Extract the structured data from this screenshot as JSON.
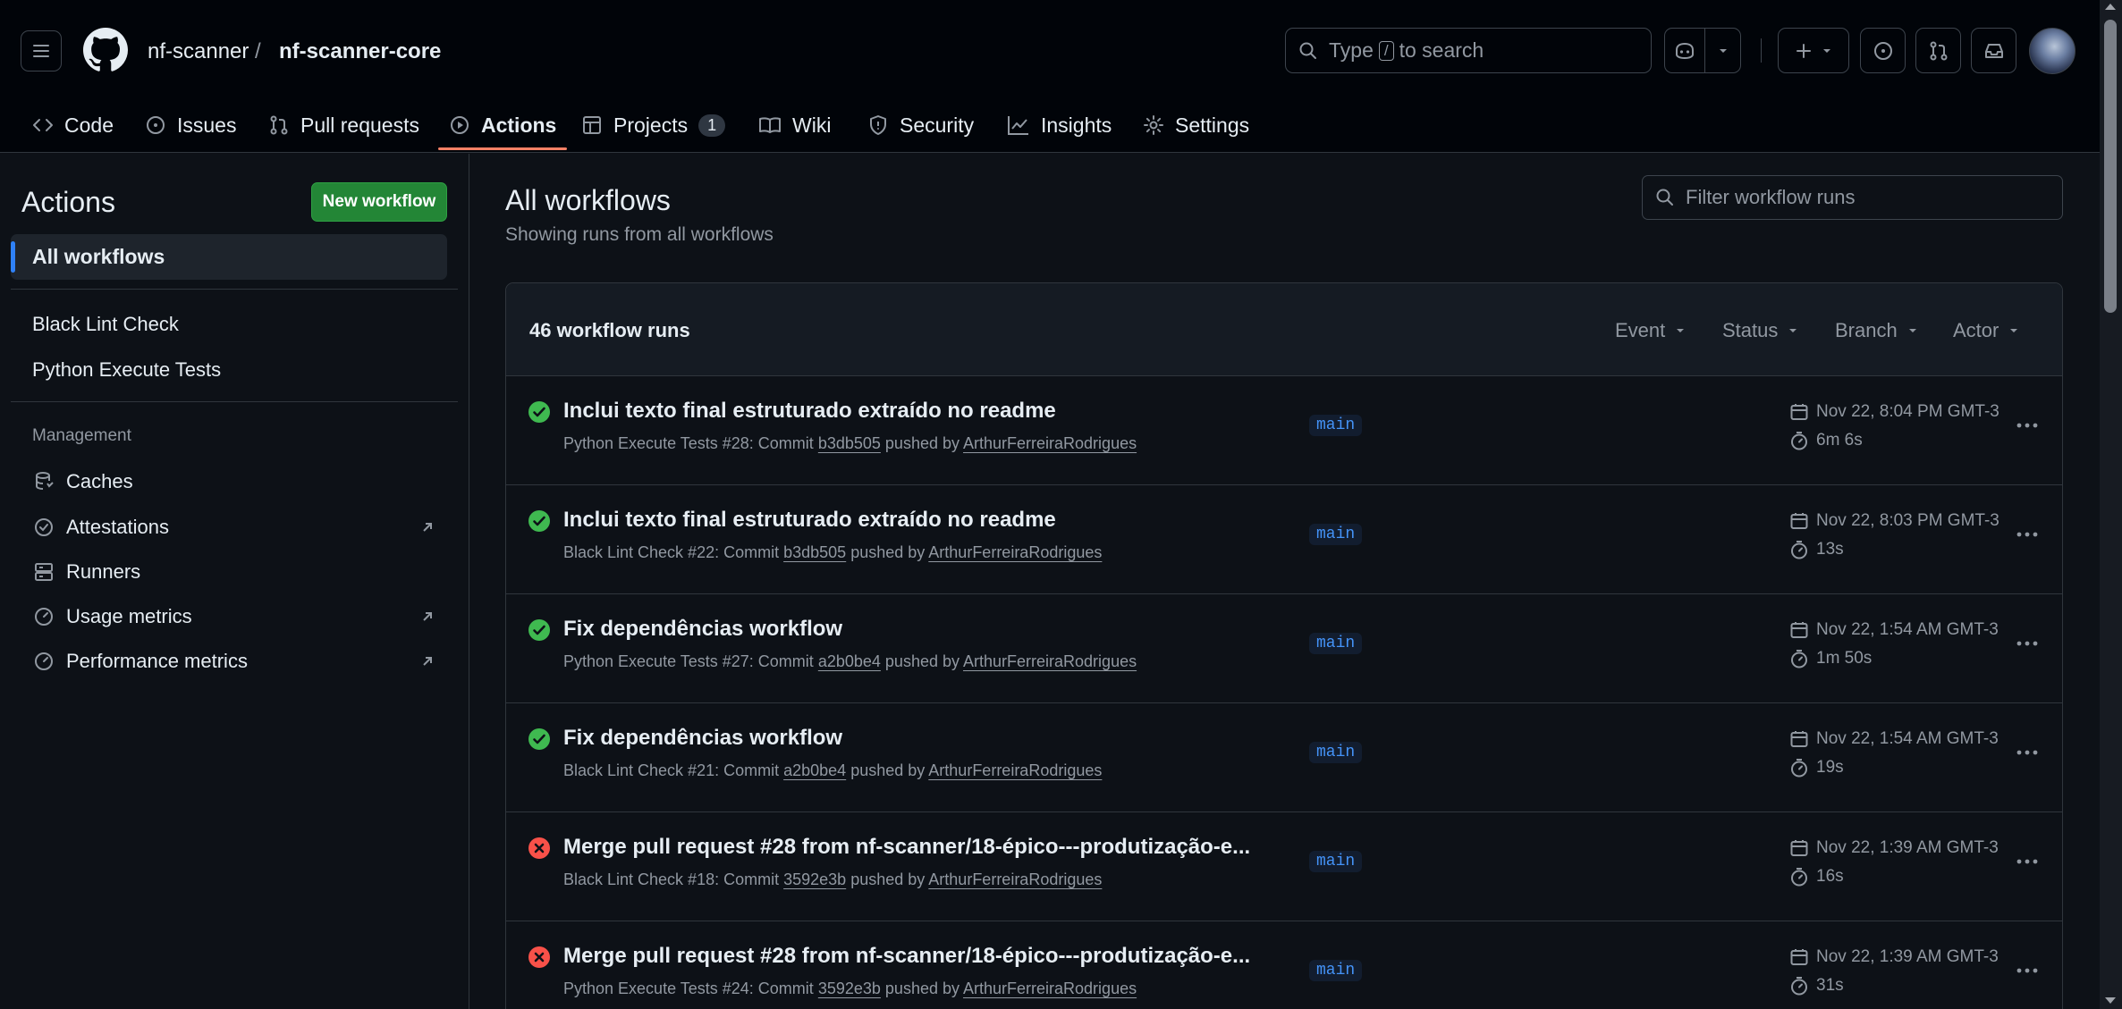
{
  "header": {
    "owner": "nf-scanner",
    "separator": "/",
    "repo": "nf-scanner-core",
    "search_prefix": "Type",
    "search_key": "/",
    "search_suffix": "to search"
  },
  "tabs": [
    {
      "label": "Code",
      "icon": "code-icon"
    },
    {
      "label": "Issues",
      "icon": "issue-icon"
    },
    {
      "label": "Pull requests",
      "icon": "pull-request-icon"
    },
    {
      "label": "Actions",
      "icon": "play-icon",
      "active": true
    },
    {
      "label": "Projects",
      "icon": "table-icon",
      "count": "1"
    },
    {
      "label": "Wiki",
      "icon": "book-icon"
    },
    {
      "label": "Security",
      "icon": "shield-icon"
    },
    {
      "label": "Insights",
      "icon": "graph-icon"
    },
    {
      "label": "Settings",
      "icon": "gear-icon"
    }
  ],
  "sidebar": {
    "title": "Actions",
    "new_workflow": "New workflow",
    "all_workflows": "All workflows",
    "workflows": [
      "Black Lint Check",
      "Python Execute Tests"
    ],
    "management_heading": "Management",
    "management": [
      {
        "label": "Caches",
        "icon": "database-icon",
        "external": false
      },
      {
        "label": "Attestations",
        "icon": "verified-icon",
        "external": true
      },
      {
        "label": "Runners",
        "icon": "server-icon",
        "external": false
      },
      {
        "label": "Usage metrics",
        "icon": "meter-icon",
        "external": true
      },
      {
        "label": "Performance metrics",
        "icon": "meter-icon",
        "external": true
      }
    ]
  },
  "main": {
    "title": "All workflows",
    "subtitle": "Showing runs from all workflows",
    "filter_placeholder": "Filter workflow runs",
    "runs_count": "46 workflow runs",
    "filters": [
      "Event",
      "Status",
      "Branch",
      "Actor"
    ],
    "runs": [
      {
        "status": "success",
        "title": "Inclui texto final estruturado extraído no readme",
        "workflow": "Python Execute Tests #28: Commit",
        "commit": "b3db505",
        "pushed_by": "pushed by",
        "user": "ArthurFerreiraRodrigues",
        "branch": "main",
        "date": "Nov 22, 8:04 PM GMT-3",
        "duration": "6m 6s"
      },
      {
        "status": "success",
        "title": "Inclui texto final estruturado extraído no readme",
        "workflow": "Black Lint Check #22: Commit",
        "commit": "b3db505",
        "pushed_by": "pushed by",
        "user": "ArthurFerreiraRodrigues",
        "branch": "main",
        "date": "Nov 22, 8:03 PM GMT-3",
        "duration": "13s"
      },
      {
        "status": "success",
        "title": "Fix dependências workflow",
        "workflow": "Python Execute Tests #27: Commit",
        "commit": "a2b0be4",
        "pushed_by": "pushed by",
        "user": "ArthurFerreiraRodrigues",
        "branch": "main",
        "date": "Nov 22, 1:54 AM GMT-3",
        "duration": "1m 50s"
      },
      {
        "status": "success",
        "title": "Fix dependências workflow",
        "workflow": "Black Lint Check #21: Commit",
        "commit": "a2b0be4",
        "pushed_by": "pushed by",
        "user": "ArthurFerreiraRodrigues",
        "branch": "main",
        "date": "Nov 22, 1:54 AM GMT-3",
        "duration": "19s"
      },
      {
        "status": "failure",
        "title": "Merge pull request #28 from nf-scanner/18-épico---produtização-e...",
        "workflow": "Black Lint Check #18: Commit",
        "commit": "3592e3b",
        "pushed_by": "pushed by",
        "user": "ArthurFerreiraRodrigues",
        "branch": "main",
        "date": "Nov 22, 1:39 AM GMT-3",
        "duration": "16s"
      },
      {
        "status": "failure",
        "title": "Merge pull request #28 from nf-scanner/18-épico---produtização-e...",
        "workflow": "Python Execute Tests #24: Commit",
        "commit": "3592e3b",
        "pushed_by": "pushed by",
        "user": "ArthurFerreiraRodrigues",
        "branch": "main",
        "date": "Nov 22, 1:39 AM GMT-3",
        "duration": "31s"
      }
    ]
  },
  "colors": {
    "success": "#3fb950",
    "failure": "#f85149",
    "primary_button": "#238636",
    "accent_underline": "#f78166",
    "link": "#4493f8"
  }
}
